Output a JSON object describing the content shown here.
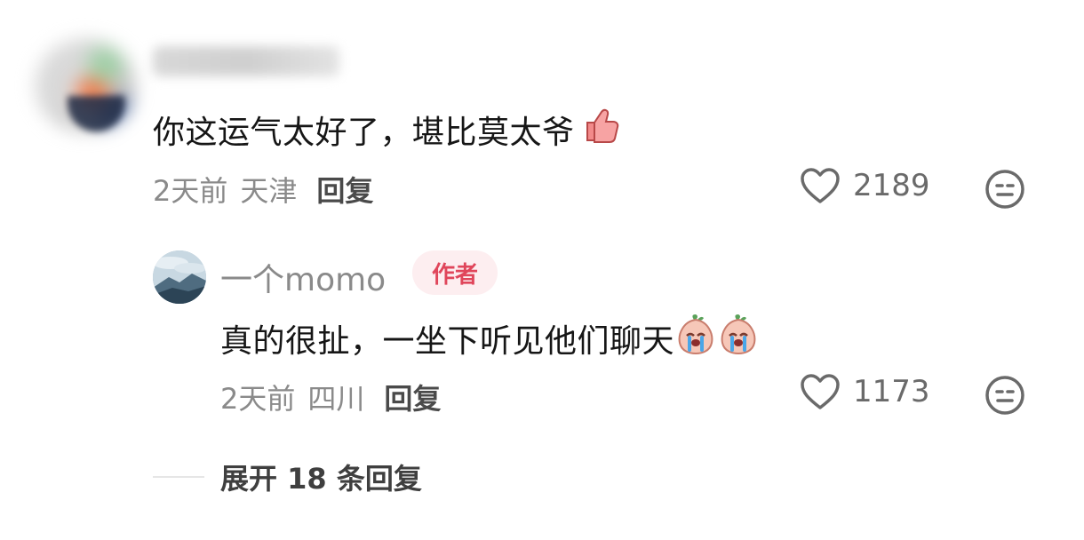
{
  "comment": {
    "username": "",
    "text": "你这运气太好了，堪比莫太爷",
    "emoji_icon": "thumbs-up-emoji",
    "time": "2天前",
    "location": "天津",
    "reply_label": "回复",
    "likes": "2189"
  },
  "reply": {
    "username": "一个momo",
    "badge": "作者",
    "text": "真的很扯，一坐下听见他们聊天",
    "emoji_icons": [
      "crying-peach-emoji",
      "crying-peach-emoji"
    ],
    "time": "2天前",
    "location": "四川",
    "reply_label": "回复",
    "likes": "1173"
  },
  "expand": {
    "label": "展开 18 条回复"
  },
  "colors": {
    "author_badge_bg": "#fdeef0",
    "author_badge_text": "#e0465b",
    "meta_text": "#8a8a8a"
  }
}
